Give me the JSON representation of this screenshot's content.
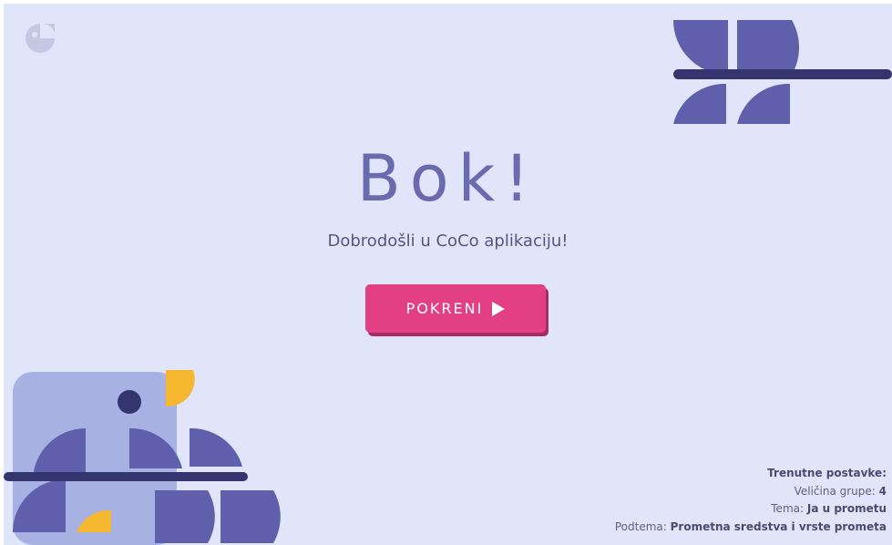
{
  "hero": {
    "title": "Bok!",
    "subtitle": "Dobrodošli u CoCo aplikaciju!"
  },
  "start_button": {
    "label": "POKRENI",
    "icon": "play-icon"
  },
  "settings": {
    "heading": "Trenutne postavke:",
    "group_size_label": "Veličina grupe:",
    "group_size_value": "4",
    "topic_label": "Tema:",
    "topic_value": "Ja u prometu",
    "subtopic_label": "Podtema:",
    "subtopic_value": "Prometna sredstva i vrste prometa"
  },
  "colors": {
    "background": "#e1e5fa",
    "title": "#6a6aaf",
    "accent": "#e23f85",
    "leaf": "#5f5fab",
    "branch": "#34346e",
    "bird": "#a7b2e3",
    "beak": "#f5b630"
  }
}
